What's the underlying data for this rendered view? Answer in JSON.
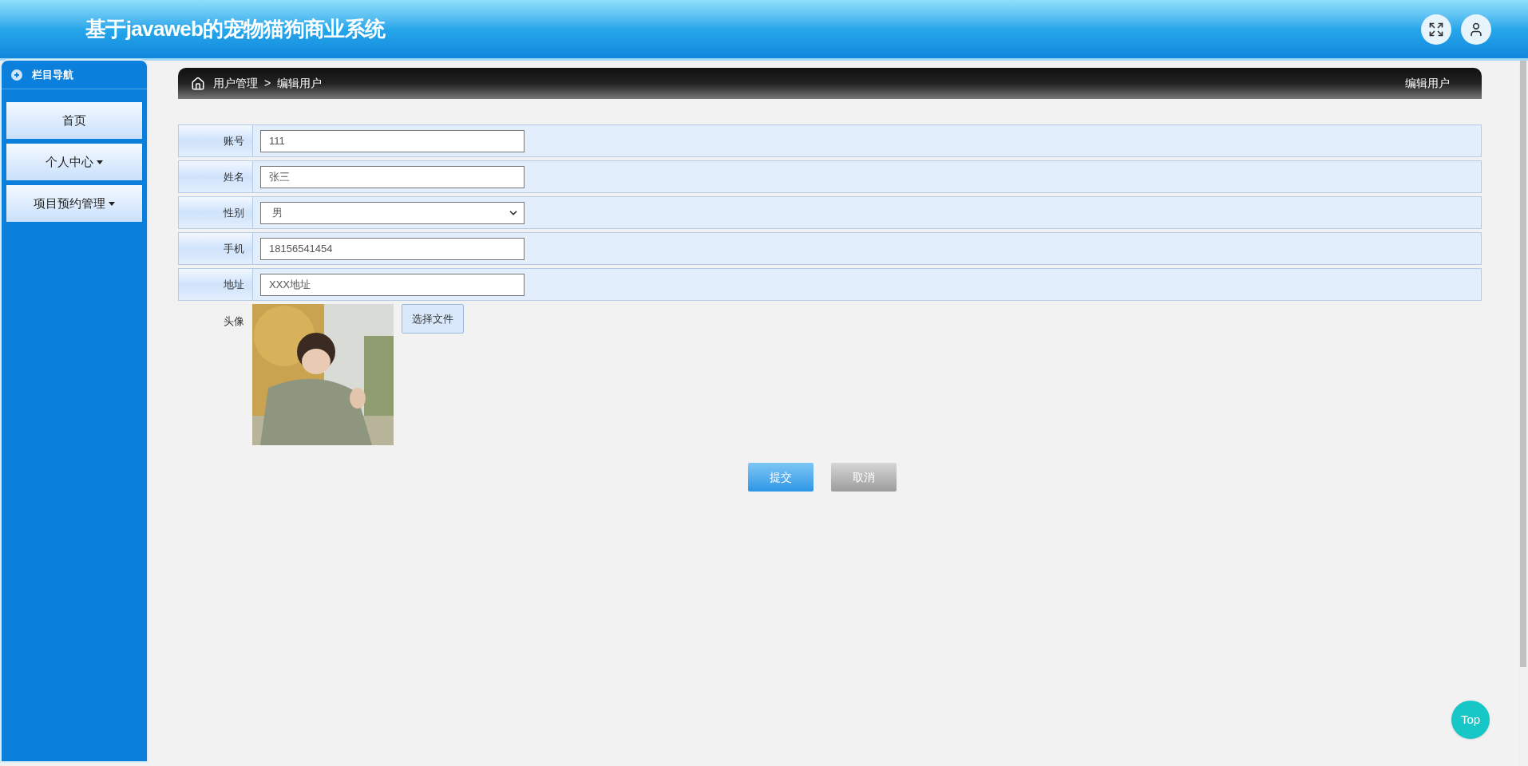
{
  "header": {
    "title": "基于javaweb的宠物猫狗商业系统"
  },
  "sidebar": {
    "title": "栏目导航",
    "items": [
      {
        "label": "首页",
        "has_dropdown": false
      },
      {
        "label": "个人中心",
        "has_dropdown": true
      },
      {
        "label": "项目预约管理",
        "has_dropdown": true
      }
    ]
  },
  "breadcrumb": {
    "section": "用户管理",
    "separator": ">",
    "page": "编辑用户",
    "right_title": "编辑用户"
  },
  "form": {
    "fields": [
      {
        "label": "账号",
        "kind": "input",
        "value": "111"
      },
      {
        "label": "姓名",
        "kind": "input",
        "value": "张三"
      },
      {
        "label": "性别",
        "kind": "select",
        "value": "男"
      },
      {
        "label": "手机",
        "kind": "input",
        "value": "18156541454"
      },
      {
        "label": "地址",
        "kind": "input",
        "value": "XXX地址"
      }
    ],
    "avatar": {
      "label": "头像",
      "button": "选择文件"
    },
    "buttons": [
      {
        "label": "提交",
        "kind": "primary"
      },
      {
        "label": "取消",
        "kind": "secondary"
      }
    ]
  },
  "top_button": "Top"
}
